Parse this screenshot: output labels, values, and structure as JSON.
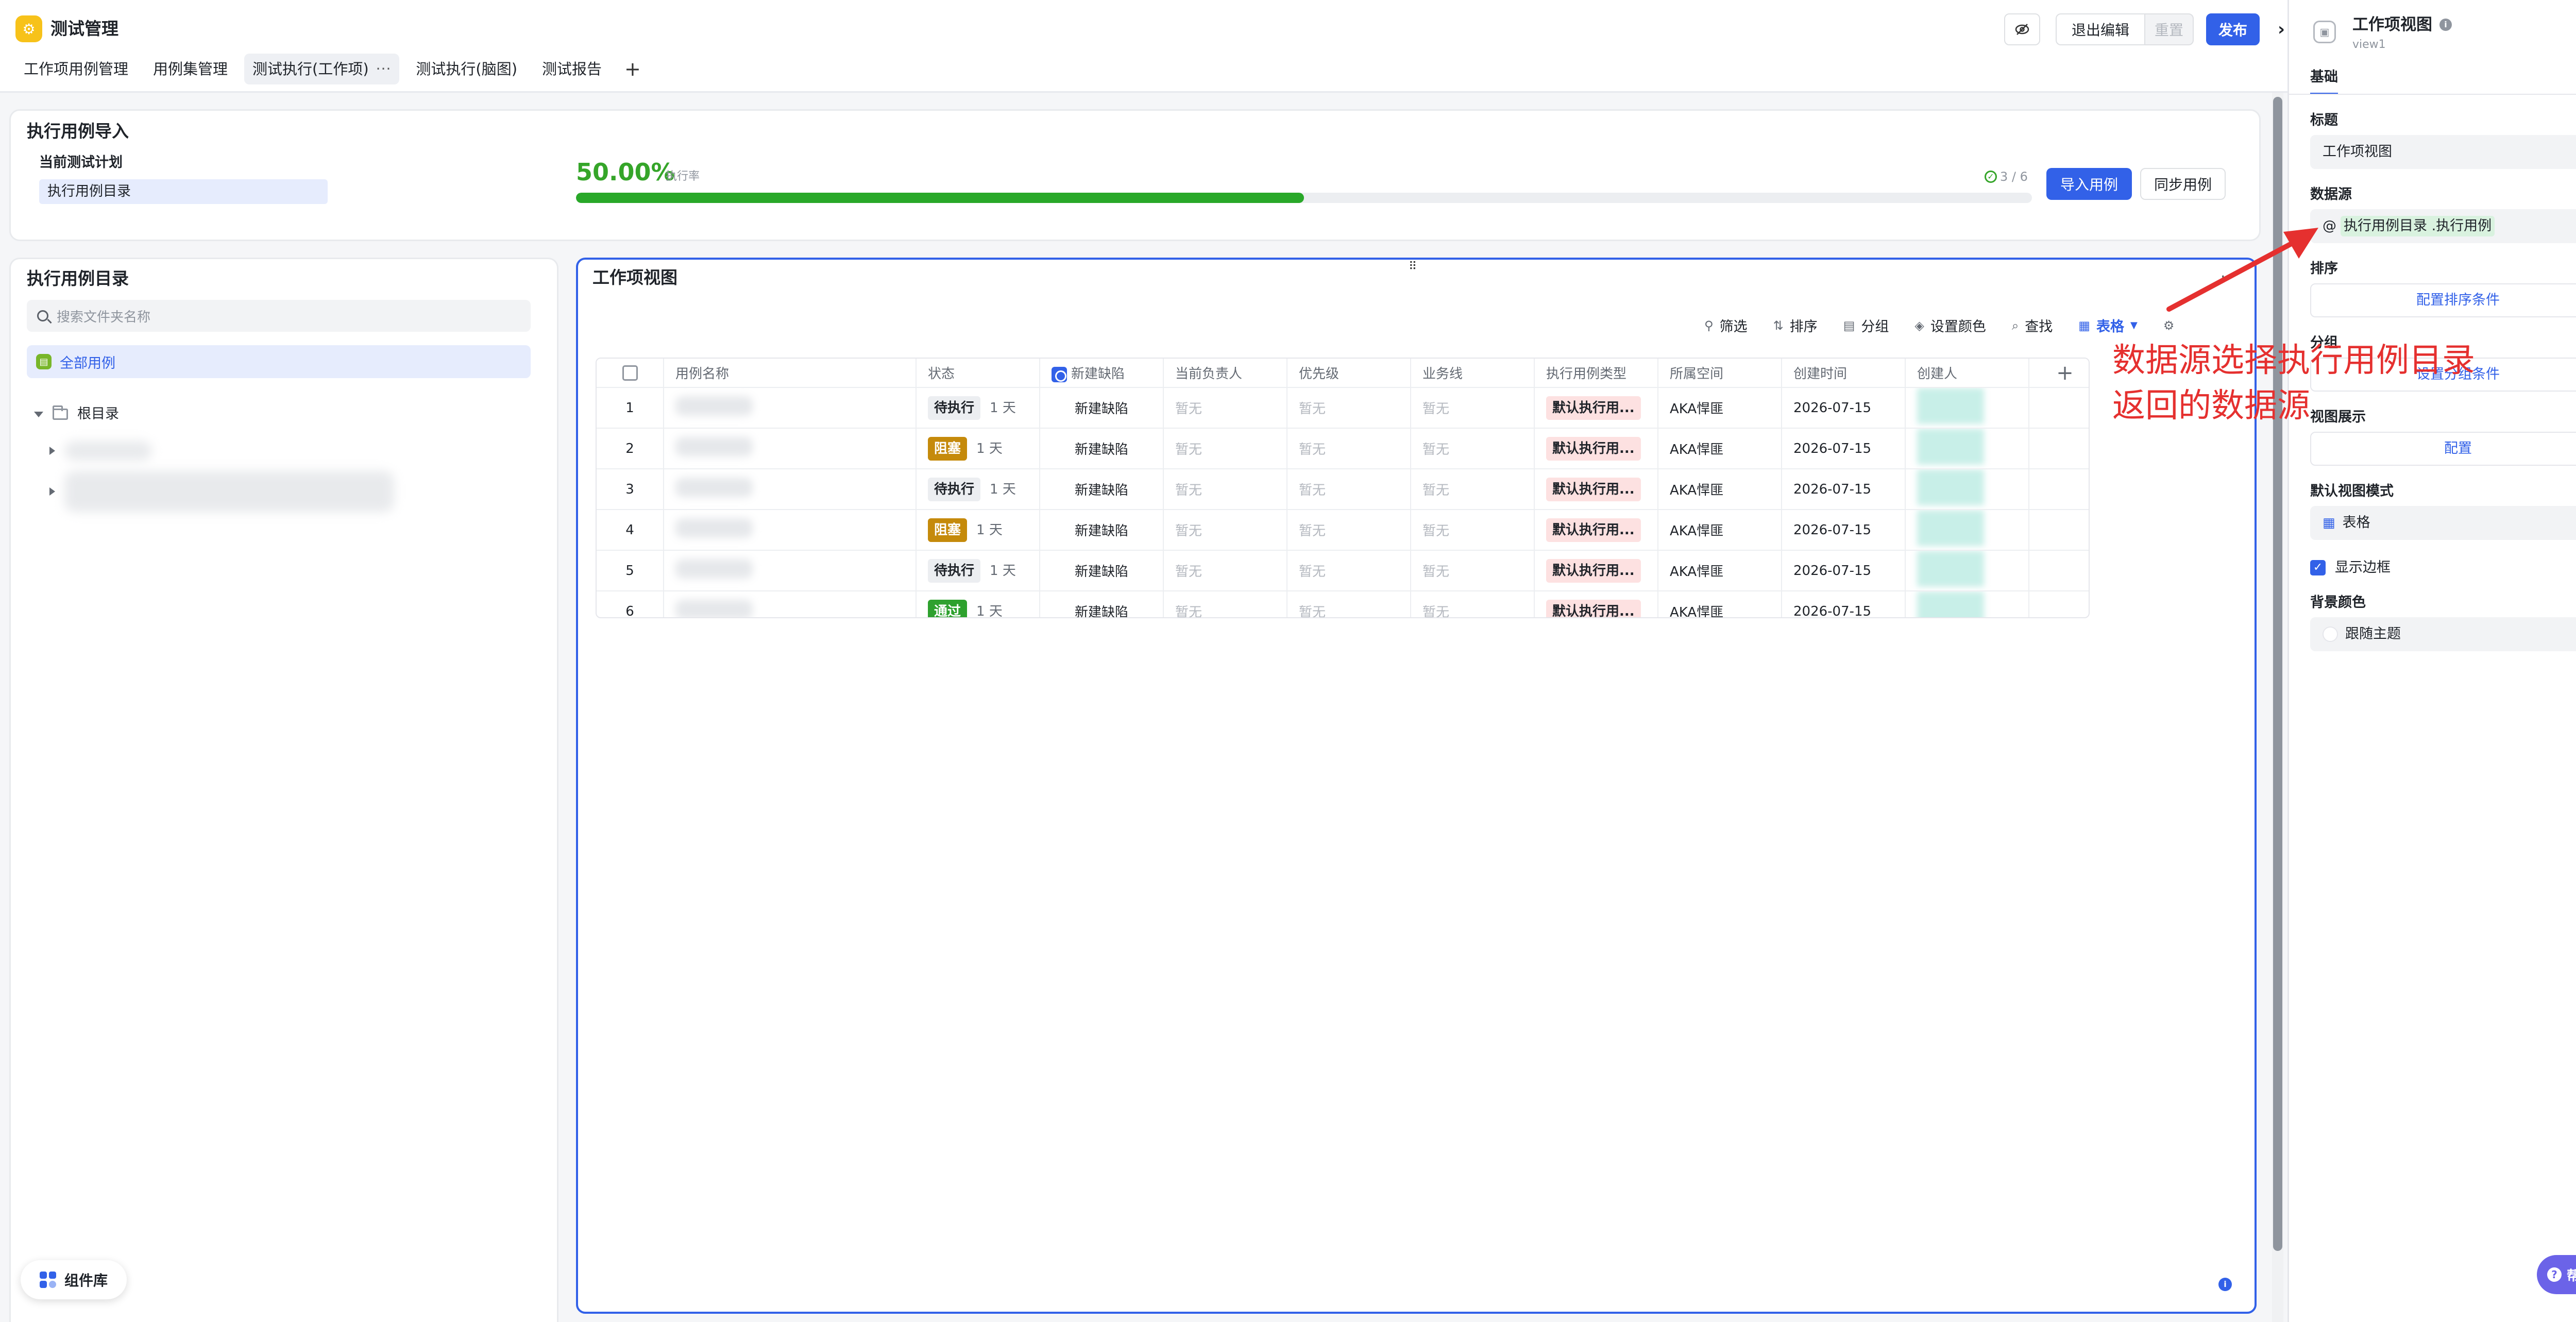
{
  "app": {
    "logo_glyph": "⚙",
    "title": "测试管理",
    "tabs": [
      {
        "label": "工作项用例管理"
      },
      {
        "label": "用例集管理"
      },
      {
        "label": "测试执行(工作项)",
        "more": "···"
      },
      {
        "label": "测试执行(脑图)"
      },
      {
        "label": "测试报告"
      }
    ],
    "add_tab": "+"
  },
  "header_actions": {
    "exit_edit": "退出编辑",
    "reset": "重置",
    "publish": "发布",
    "collapse": "›"
  },
  "import_section": {
    "title": "执行用例导入",
    "current_plan_label": "当前测试计划",
    "catalog_item": "执行用例目录",
    "execution_rate": "50.00%",
    "execution_rate_label": "执行率",
    "progress_percent": 50,
    "passed_count": "3 / 6",
    "import_button": "导入用例",
    "sync_button": "同步用例"
  },
  "directory": {
    "title": "执行用例目录",
    "search_placeholder": "搜索文件夹名称",
    "all_cases": "全部用例",
    "root": "根目录"
  },
  "component_library": "组件库",
  "work_view": {
    "title": "工作项视图",
    "drag_handle": "⠿",
    "more": "···",
    "toolbar": {
      "filter": "筛选",
      "sort": "排序",
      "group": "分组",
      "color": "设置颜色",
      "find": "查找",
      "view_mode": "表格"
    },
    "columns": [
      "用例名称",
      "状态",
      "新建缺陷",
      "当前负责人",
      "优先级",
      "业务线",
      "执行用例类型",
      "所属空间",
      "创建时间",
      "创建人"
    ],
    "add_column": "+",
    "rows": [
      {
        "no": "1",
        "status": "待执行",
        "status_kind": "pending",
        "duration": "1 天",
        "defect": "新建缺陷",
        "owner": "暂无",
        "priority": "暂无",
        "business": "暂无",
        "type": "默认执行用...",
        "space": "AKA悍匪",
        "created": "2026-07-15"
      },
      {
        "no": "2",
        "status": "阻塞",
        "status_kind": "blocked",
        "duration": "1 天",
        "defect": "新建缺陷",
        "owner": "暂无",
        "priority": "暂无",
        "business": "暂无",
        "type": "默认执行用...",
        "space": "AKA悍匪",
        "created": "2026-07-15"
      },
      {
        "no": "3",
        "status": "待执行",
        "status_kind": "pending",
        "duration": "1 天",
        "defect": "新建缺陷",
        "owner": "暂无",
        "priority": "暂无",
        "business": "暂无",
        "type": "默认执行用...",
        "space": "AKA悍匪",
        "created": "2026-07-15"
      },
      {
        "no": "4",
        "status": "阻塞",
        "status_kind": "blocked",
        "duration": "1 天",
        "defect": "新建缺陷",
        "owner": "暂无",
        "priority": "暂无",
        "business": "暂无",
        "type": "默认执行用...",
        "space": "AKA悍匪",
        "created": "2026-07-15"
      },
      {
        "no": "5",
        "status": "待执行",
        "status_kind": "pending",
        "duration": "1 天",
        "defect": "新建缺陷",
        "owner": "暂无",
        "priority": "暂无",
        "business": "暂无",
        "type": "默认执行用...",
        "space": "AKA悍匪",
        "created": "2026-07-15"
      },
      {
        "no": "6",
        "status": "通过",
        "status_kind": "pass",
        "duration": "1 天",
        "defect": "新建缺陷",
        "owner": "暂无",
        "priority": "暂无",
        "business": "暂无",
        "type": "默认执行用...",
        "space": "AKA悍匪",
        "created": "2026-07-15"
      }
    ]
  },
  "panel": {
    "title": "工作项视图",
    "subtitle": "view1",
    "tab": "基础",
    "title_label": "标题",
    "title_value": "工作项视图",
    "datasource_label": "数据源",
    "datasource_at": "@",
    "datasource_value": "执行用例目录 .执行用例",
    "sort_label": "排序",
    "sort_link": "配置排序条件",
    "group_label": "分组",
    "group_link": "设置分组条件",
    "display_label": "视图展示",
    "display_link": "配置",
    "default_mode_label": "默认视图模式",
    "default_mode_value": "表格",
    "show_border": "显示边框",
    "bg_color_label": "背景颜色",
    "bg_color_value": "跟随主题",
    "help": "帮助"
  },
  "annotation": {
    "line1": "数据源选择执行用例目录",
    "line2": "返回的数据源"
  },
  "colors": {
    "primary": "#3261e8",
    "success": "#29a829",
    "blocked": "#c58a0b",
    "annotation": "#e5302f"
  }
}
